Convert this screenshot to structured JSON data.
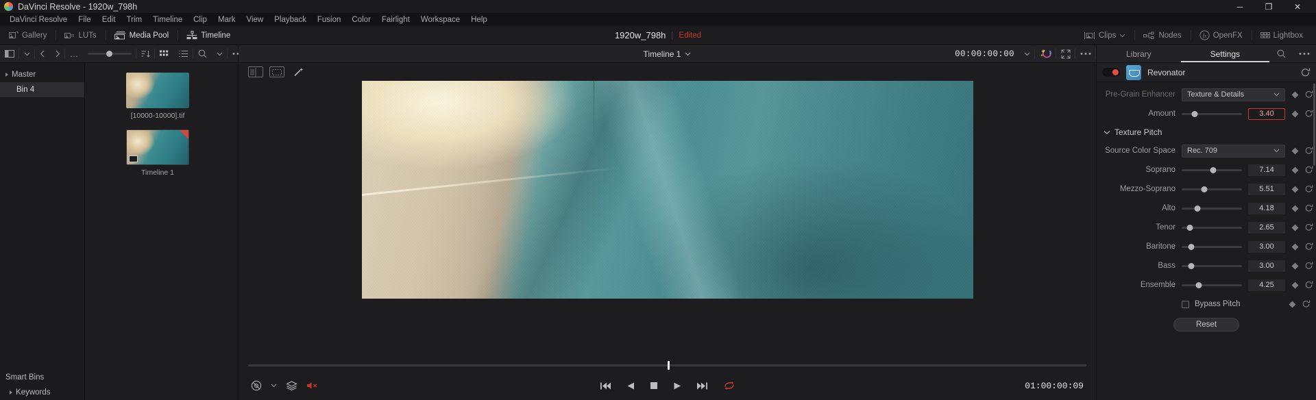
{
  "titlebar": {
    "app_title": "DaVinci Resolve - 1920w_798h",
    "minimize": "─",
    "maximize": "❐",
    "close": "✕"
  },
  "menubar": {
    "items": [
      "DaVinci Resolve",
      "File",
      "Edit",
      "Trim",
      "Timeline",
      "Clip",
      "Mark",
      "View",
      "Playback",
      "Fusion",
      "Color",
      "Fairlight",
      "Workspace",
      "Help"
    ]
  },
  "main_toolbar": {
    "left_buttons": [
      {
        "label": "Gallery",
        "icon": "gallery-icon",
        "active": false
      },
      {
        "label": "LUTs",
        "icon": "luts-icon",
        "active": false
      },
      {
        "label": "Media Pool",
        "icon": "media-pool-icon",
        "active": true
      },
      {
        "label": "Timeline",
        "icon": "timeline-icon",
        "active": true
      }
    ],
    "project_name": "1920w_798h",
    "status": "Edited",
    "right_buttons": [
      {
        "label": "Clips",
        "icon": "clips-icon",
        "has_chevron": true
      },
      {
        "label": "Nodes",
        "icon": "nodes-icon",
        "has_chevron": false
      },
      {
        "label": "OpenFX",
        "icon": "openfx-icon",
        "has_chevron": false
      },
      {
        "label": "Lightbox",
        "icon": "lightbox-icon",
        "has_chevron": false
      }
    ]
  },
  "media_pool": {
    "toolbar": {
      "sort_icon": "sort-icon",
      "grid_icon": "grid-view-icon",
      "list_icon": "list-view-icon",
      "search_icon": "search-icon",
      "more_icon": "more-options-icon",
      "zoom_level": "100%",
      "back_icon": "back-arrow-icon",
      "forward_icon": "forward-arrow-icon",
      "ellipsis": "…"
    },
    "bins": [
      {
        "label": "Master",
        "level": 0,
        "selected": false,
        "expandable": true
      },
      {
        "label": "Bin 4",
        "level": 1,
        "selected": true,
        "expandable": false
      }
    ],
    "smart_bins_header": "Smart Bins",
    "smart_bins": [
      {
        "label": "Keywords",
        "expandable": true
      }
    ],
    "clips": [
      {
        "label": "[10000-10000].tif",
        "type": "still"
      },
      {
        "label": "Timeline 1",
        "type": "timeline"
      }
    ]
  },
  "viewer": {
    "timeline_name": "Timeline 1",
    "timecode_top": "00:00:00:00",
    "timecode_bottom": "01:00:00:09",
    "enhance_icon": "magic-enhance-icon",
    "fullscreen_icon": "fullscreen-icon",
    "options_icon": "more-options-icon",
    "safe_area_icon": "safe-area-icon",
    "split_icon": "split-view-icon",
    "wand_icon": "wand-icon",
    "bypass_icon": "bypass-color-icon",
    "stack_icon": "layers-icon",
    "mute_icon": "mute-audio-icon",
    "transport": [
      {
        "name": "jump-to-start-button",
        "glyph": "⏮"
      },
      {
        "name": "play-reverse-button",
        "glyph": "◀"
      },
      {
        "name": "stop-button",
        "glyph": "■"
      },
      {
        "name": "play-button",
        "glyph": "▶"
      },
      {
        "name": "jump-to-end-button",
        "glyph": "⏭"
      },
      {
        "name": "loop-button",
        "glyph": "↻"
      }
    ]
  },
  "inspector": {
    "tabs": [
      {
        "label": "Library",
        "active": false
      },
      {
        "label": "Settings",
        "active": true
      }
    ],
    "search_icon": "search-icon",
    "more_icon": "more-options-icon",
    "effect": {
      "name": "Revonator",
      "enabled": true,
      "reset_icon": "reset-icon"
    },
    "params": [
      {
        "type": "select",
        "label": "Pre-Grain Enhancer",
        "value": "Texture & Details",
        "dimmed": true
      },
      {
        "type": "slider",
        "label": "Amount",
        "value": "3.40",
        "knob_pct": 22,
        "editing": true
      },
      {
        "type": "group",
        "label": "Texture Pitch",
        "expanded": true
      },
      {
        "type": "select",
        "label": "Source Color Space",
        "value": "Rec. 709",
        "dimmed": false
      },
      {
        "type": "slider",
        "label": "Soprano",
        "value": "7.14",
        "knob_pct": 52
      },
      {
        "type": "slider",
        "label": "Mezzo-Soprano",
        "value": "5.51",
        "knob_pct": 37
      },
      {
        "type": "slider",
        "label": "Alto",
        "value": "4.18",
        "knob_pct": 26
      },
      {
        "type": "slider",
        "label": "Tenor",
        "value": "2.65",
        "knob_pct": 14
      },
      {
        "type": "slider",
        "label": "Baritone",
        "value": "3.00",
        "knob_pct": 16
      },
      {
        "type": "slider",
        "label": "Bass",
        "value": "3.00",
        "knob_pct": 16
      },
      {
        "type": "slider",
        "label": "Ensemble",
        "value": "4.25",
        "knob_pct": 28
      },
      {
        "type": "checkbox",
        "label": "Bypass Pitch",
        "checked": false
      },
      {
        "type": "button",
        "label": "Reset"
      }
    ]
  },
  "colors": {
    "accent_red": "#c8372d",
    "panel_bg": "#1d1d1f",
    "toolbar_bg": "#232326",
    "text_primary": "#d6d6d9",
    "text_secondary": "#9a9a9d"
  }
}
